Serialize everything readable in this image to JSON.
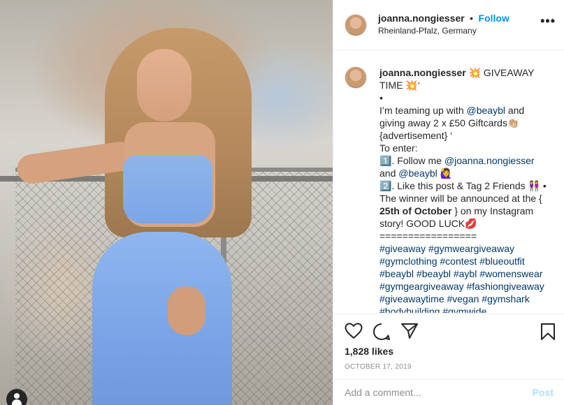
{
  "post": {
    "username": "joanna.nongiesser",
    "separator": "•",
    "follow_label": "Follow",
    "location": "Rheinland-Pfalz, Germany",
    "more_label": "•••"
  },
  "caption": {
    "username": "joanna.nongiesser",
    "line1": "💥 GIVEAWAY TIME 💥‘",
    "line2": "•",
    "line3a": "I’m teaming up with ",
    "mention1": "@beaybl",
    "line3b": " and giving away 2 x £50 Giftcards👏🏼 {advertisement} ‘",
    "line4": "To enter:",
    "line5a": "1️⃣. Follow me ",
    "mention2": "@joanna.nongiesser",
    "line5b": " and ",
    "mention3": "@beaybl",
    "line5c": " 🙋‍♀️",
    "line6a": "2️⃣. Like this post & Tag 2 Friends 👭 • The winner will be announced at the { ",
    "line6bold": "25th of October",
    "line6b": " } on my Instagram story! GOOD LUCK💋",
    "line7": "=================",
    "hashtags": "#giveaway #gymweargiveaway #gymclothing #contest #blueoutfit #beaybl #beaybl #aybl #womenswear #gymgeargiveaway #fashiongiveaway #giveawaytime #vegan #gymshark #bodybuilding #gymwide"
  },
  "actions": {
    "like_icon": "heart-icon",
    "comment_icon": "comment-icon",
    "share_icon": "share-icon",
    "save_icon": "bookmark-icon"
  },
  "likes": "1,828 likes",
  "date": "OCTOBER 17, 2019",
  "comment_box": {
    "placeholder": "Add a comment...",
    "post_label": "Post"
  },
  "colors": {
    "follow": "#0095f6",
    "post_disabled": "#b2dffc",
    "link": "#00376b",
    "muted": "#8e8e8e"
  }
}
